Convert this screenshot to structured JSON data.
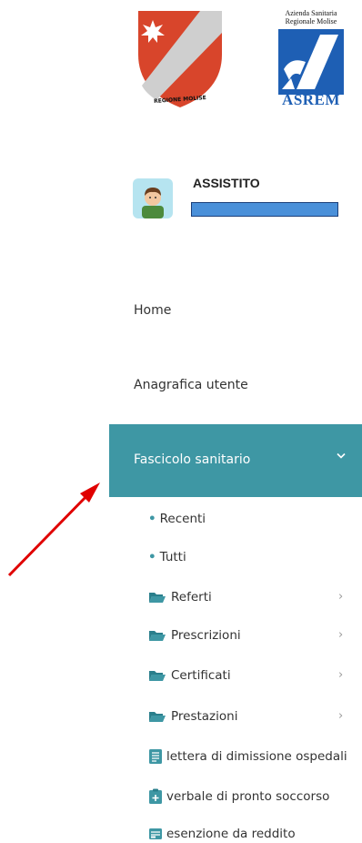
{
  "logos": {
    "region_text": "REGIONE MOLISE",
    "asrem_caption_line1": "Azienda Sanitaria",
    "asrem_caption_line2": "Regionale Molise",
    "asrem_word": "ASREM"
  },
  "user": {
    "role": "ASSISTITO",
    "avatar_icon": "user-avatar-icon"
  },
  "menu": {
    "home": "Home",
    "anagrafica": "Anagrafica utente",
    "fascicolo": "Fascicolo sanitario",
    "fascicolo_icon": "chevron-down-icon"
  },
  "submenu": {
    "recenti": "Recenti",
    "tutti": "Tutti",
    "referti": "Referti",
    "prescrizioni": "Prescrizioni",
    "certificati": "Certificati",
    "prestazioni": "Prestazioni",
    "lettera": "lettera di dimissione ospedali",
    "verbale": "verbale di pronto soccorso",
    "esenzione": "esenzione da reddito"
  },
  "colors": {
    "active_bg": "#3e97a4",
    "accent_red": "#e00000",
    "brand_blue": "#1e5fb4"
  }
}
